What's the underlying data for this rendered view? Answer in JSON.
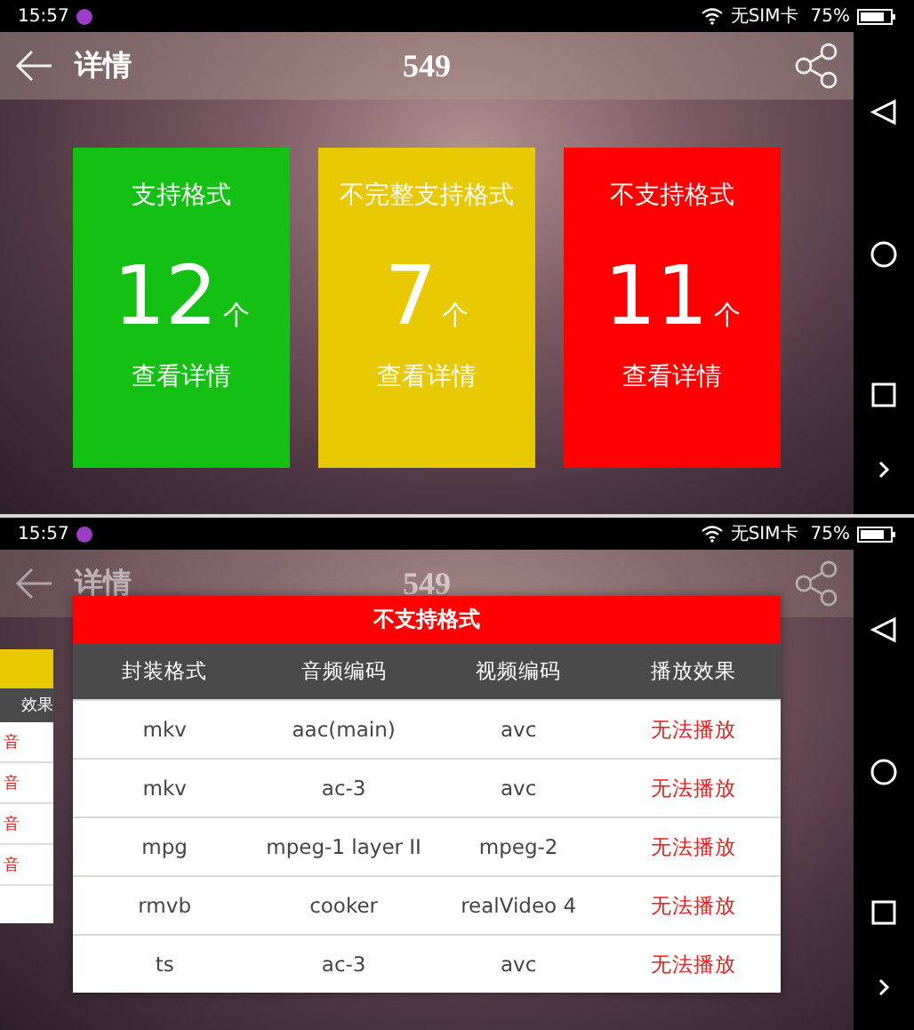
{
  "screens": [
    {
      "status_bar": {
        "time": "15:57",
        "sim": "无SIM卡",
        "battery": "75%"
      },
      "header": {
        "title": "详情",
        "count": "549"
      },
      "cards": [
        {
          "title": "支持格式",
          "count": "12",
          "unit": "个",
          "link": "查看详情",
          "color": "#14c014"
        },
        {
          "title": "不完整支持格式",
          "count": "7",
          "unit": "个",
          "link": "查看详情",
          "color": "#e8c800"
        },
        {
          "title": "不支持格式",
          "count": "11",
          "unit": "个",
          "link": "查看详情",
          "color": "#ff0000"
        }
      ]
    },
    {
      "status_bar": {
        "time": "15:57",
        "sim": "无SIM卡",
        "battery": "75%"
      },
      "header": {
        "title": "详情",
        "count": "549"
      },
      "back_panel": {
        "header": "效果",
        "rows": [
          "音",
          "音",
          "音",
          "音"
        ]
      },
      "dialog": {
        "title": "不支持格式",
        "columns": [
          "封装格式",
          "音频编码",
          "视频编码",
          "播放效果"
        ],
        "rows": [
          [
            "mkv",
            "aac(main)",
            "avc",
            "无法播放"
          ],
          [
            "mkv",
            "ac-3",
            "avc",
            "无法播放"
          ],
          [
            "mpg",
            "mpeg-1 layer II",
            "mpeg-2",
            "无法播放"
          ],
          [
            "rmvb",
            "cooker",
            "realVideo 4",
            "无法播放"
          ],
          [
            "ts",
            "ac-3",
            "avc",
            "无法播放"
          ]
        ]
      }
    }
  ]
}
